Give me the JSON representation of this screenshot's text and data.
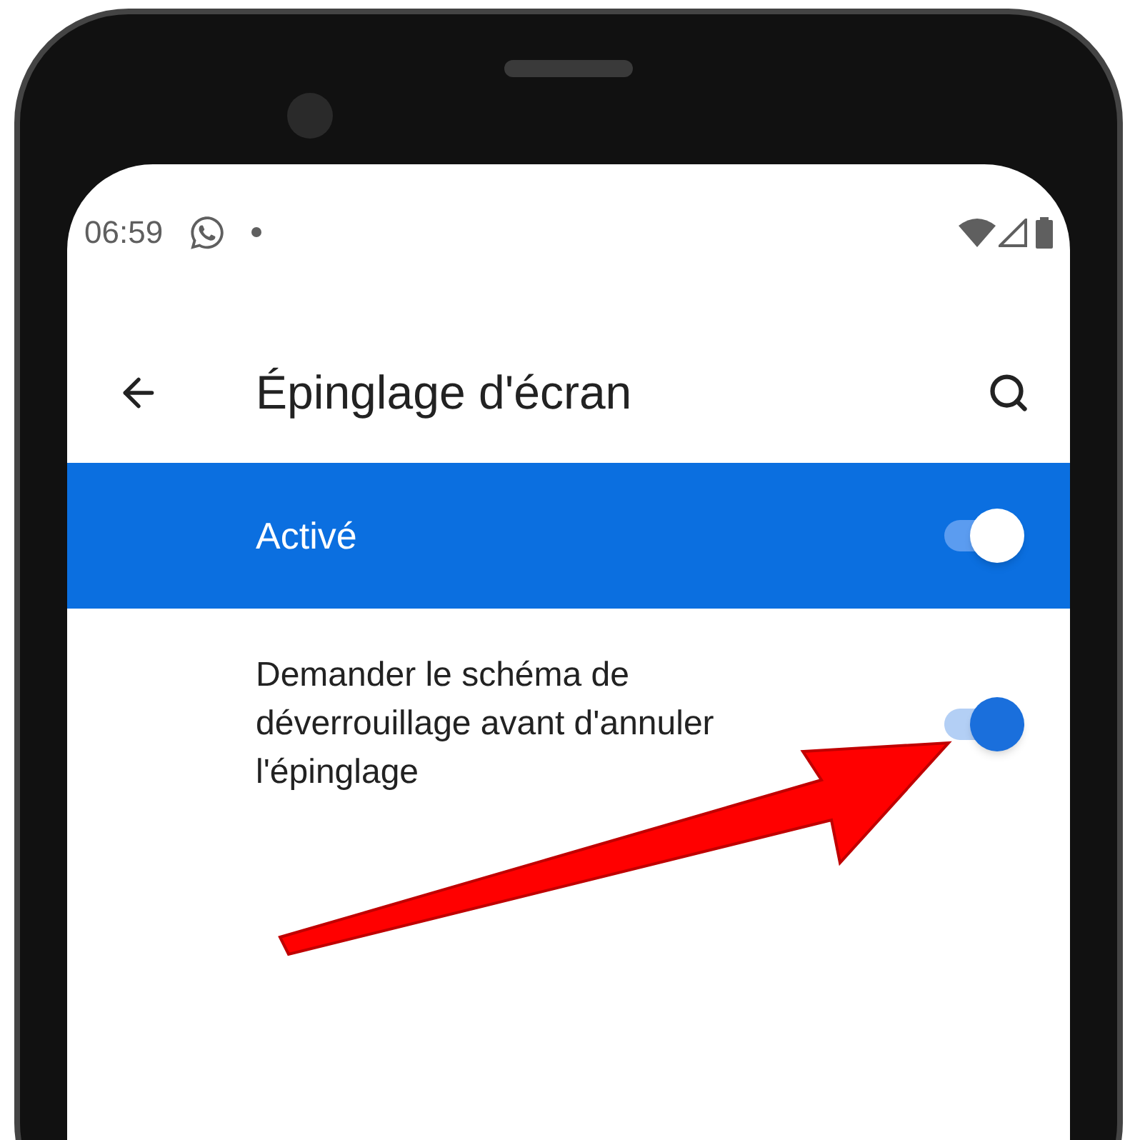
{
  "status_bar": {
    "time": "06:59"
  },
  "toolbar": {
    "title": "Épinglage d'écran"
  },
  "main_switch": {
    "label": "Activé",
    "on": true
  },
  "settings": [
    {
      "label": "Demander le schéma de déverrouillage avant d'annuler l'épinglage",
      "on": true
    }
  ]
}
